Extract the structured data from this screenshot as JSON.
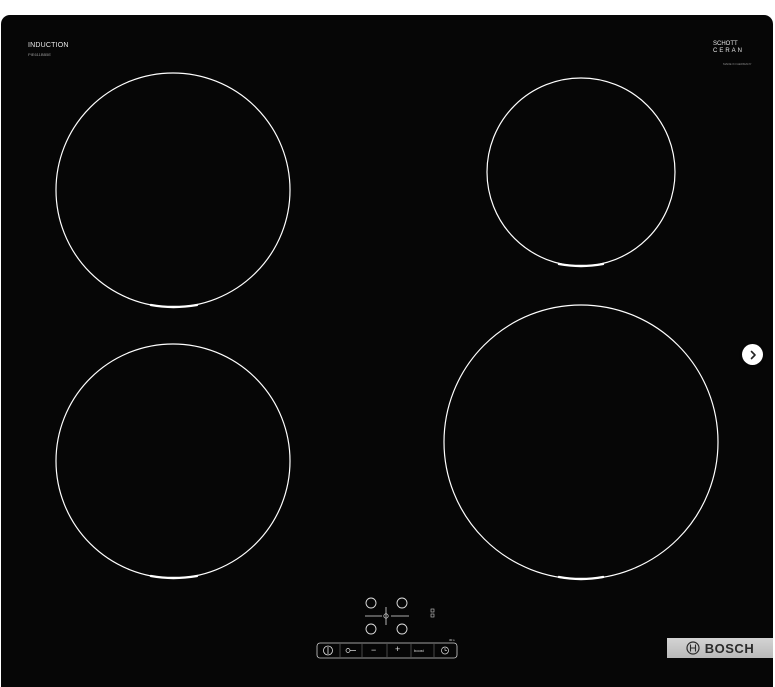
{
  "cooktop": {
    "type_label": "INDUCTION",
    "model_label": "PIE611BB5E",
    "ceran_line1": "SCHOTT",
    "ceran_line2": "CERAN",
    "ceran_small": "MADE IN GERMANY"
  },
  "controls": {
    "plus_label": "+",
    "minus_label": "−",
    "boost_label": "boost",
    "small_label": "30 s"
  },
  "brand": {
    "name": "BOSCH"
  },
  "navigation": {
    "next_icon": "chevron-right-icon"
  },
  "colors": {
    "glass": "#060606",
    "zone_ring": "#ffffff",
    "plate": "#c6c6c6"
  }
}
